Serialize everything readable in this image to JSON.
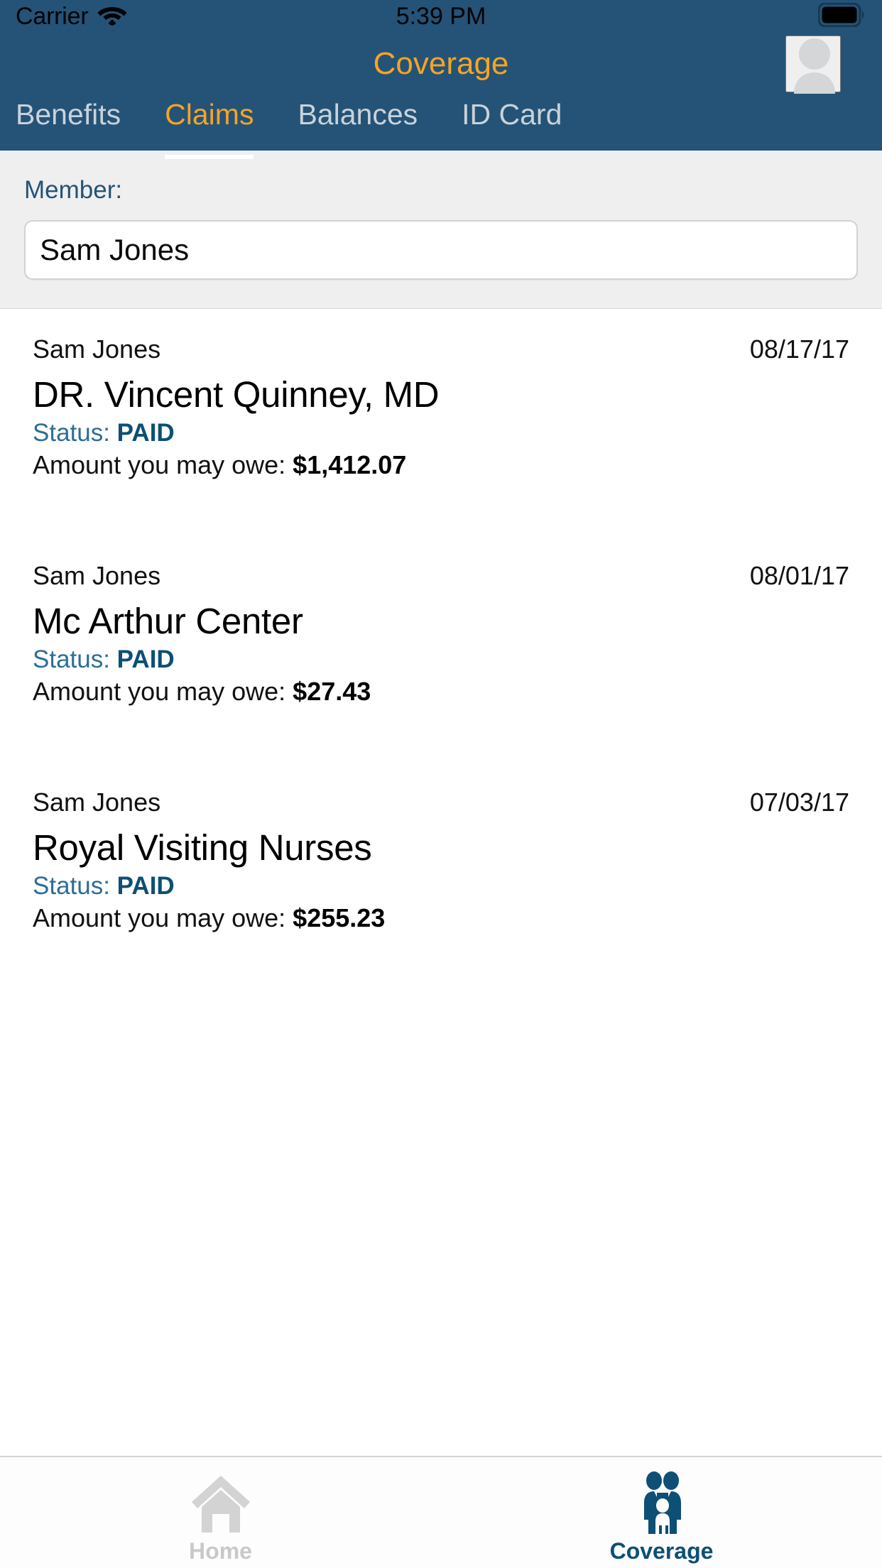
{
  "status_bar": {
    "carrier": "Carrier",
    "time": "5:39 PM",
    "wifi_icon": "wifi-icon",
    "battery_icon": "battery-full-icon"
  },
  "header": {
    "title": "Coverage",
    "title_color": "#F5A425",
    "background_color": "#245377",
    "avatar_icon": "user-avatar-icon"
  },
  "tabs": {
    "active_index": 1,
    "items": [
      {
        "label": "Benefits"
      },
      {
        "label": "Claims"
      },
      {
        "label": "Balances"
      },
      {
        "label": "ID Card"
      }
    ]
  },
  "member_filter": {
    "label": "Member:",
    "selected": "Sam Jones",
    "placeholder": "Select member"
  },
  "claims": {
    "status_prefix": "Status: ",
    "amount_prefix": "Amount you may owe: ",
    "items": [
      {
        "member": "Sam Jones",
        "date": "08/17/17",
        "provider": "DR. Vincent Quinney, MD",
        "status": "PAID",
        "amount": "$1,412.07"
      },
      {
        "member": "Sam Jones",
        "date": "08/01/17",
        "provider": "Mc Arthur Center",
        "status": "PAID",
        "amount": "$27.43"
      },
      {
        "member": "Sam Jones",
        "date": "07/03/17",
        "provider": "Royal Visiting Nurses",
        "status": "PAID",
        "amount": "$255.23"
      }
    ]
  },
  "bottom_nav": {
    "active_index": 1,
    "items": [
      {
        "label": "Home",
        "icon": "home-icon"
      },
      {
        "label": "Coverage",
        "icon": "family-icon"
      }
    ]
  },
  "colors": {
    "brand_blue": "#245377",
    "accent_orange": "#F5A425",
    "status_blue": "#0d4f75",
    "panel_gray": "#EFEFEF"
  }
}
